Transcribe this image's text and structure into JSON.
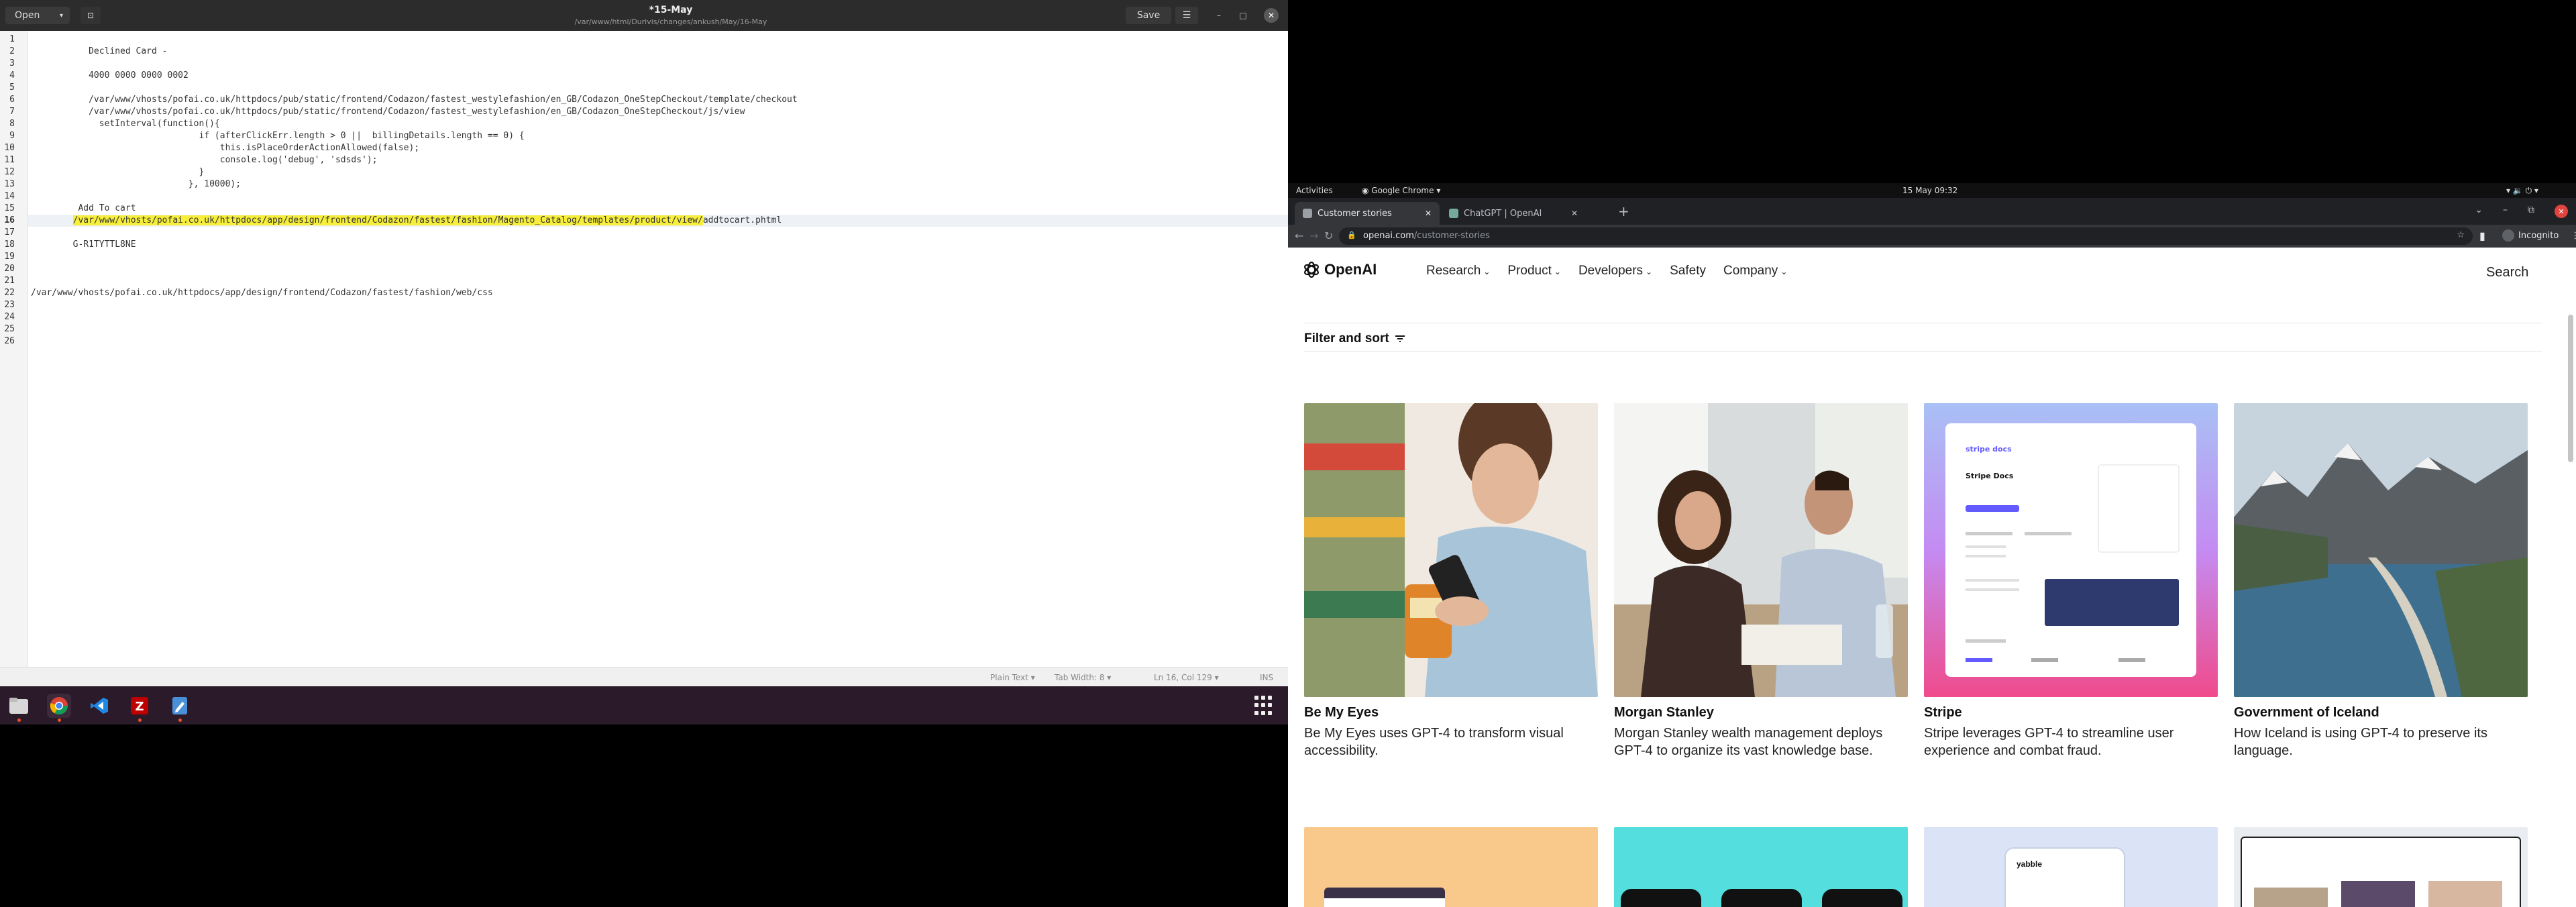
{
  "gedit": {
    "open_label": "Open",
    "title": "*15-May",
    "path": "/var/www/html/Durivis/changes/ankush/May/16-May",
    "save_label": "Save",
    "lines": [
      {
        "n": "1",
        "text": ""
      },
      {
        "n": "2",
        "text": "           Declined Card -"
      },
      {
        "n": "3",
        "text": ""
      },
      {
        "n": "4",
        "text": "           4000 0000 0000 0002"
      },
      {
        "n": "5",
        "text": ""
      },
      {
        "n": "6",
        "text": "           /var/www/vhosts/pofai.co.uk/httpdocs/pub/static/frontend/Codazon/fastest_westylefashion/en_GB/Codazon_OneStepCheckout/template/checkout"
      },
      {
        "n": "7",
        "text": "           /var/www/vhosts/pofai.co.uk/httpdocs/pub/static/frontend/Codazon/fastest_westylefashion/en_GB/Codazon_OneStepCheckout/js/view"
      },
      {
        "n": "8",
        "text": "             setInterval(function(){"
      },
      {
        "n": "9",
        "text": "                                if (afterClickErr.length > 0 ||  billingDetails.length == 0) {"
      },
      {
        "n": "10",
        "text": "                                    this.isPlaceOrderActionAllowed(false);"
      },
      {
        "n": "11",
        "text": "                                    console.log('debug', 'sdsds');"
      },
      {
        "n": "12",
        "text": "                                }"
      },
      {
        "n": "13",
        "text": "                              }, 10000);"
      },
      {
        "n": "14",
        "text": ""
      },
      {
        "n": "15",
        "text": "         Add To cart"
      },
      {
        "n": "16",
        "text": ""
      },
      {
        "n": "17",
        "text": ""
      },
      {
        "n": "18",
        "text": "        G-R1TYTTL8NE"
      },
      {
        "n": "19",
        "text": ""
      },
      {
        "n": "20",
        "text": ""
      },
      {
        "n": "21",
        "text": ""
      },
      {
        "n": "22",
        "text": "/var/www/vhosts/pofai.co.uk/httpdocs/app/design/frontend/Codazon/fastest/fashion/web/css"
      },
      {
        "n": "23",
        "text": ""
      },
      {
        "n": "24",
        "text": ""
      },
      {
        "n": "25",
        "text": ""
      },
      {
        "n": "26",
        "text": ""
      }
    ],
    "line16_prefix": "        ",
    "line16_highlight": "/var/www/vhosts/pofai.co.uk/httpdocs/app/design/frontend/Codazon/fastest/fashion/Magento_Catalog/templates/product/view/",
    "line16_rest": "addtocart.phtml",
    "status": {
      "mode": "Plain Text",
      "tab_width": "Tab Width: 8",
      "position": "Ln 16, Col 129",
      "ins": "INS"
    }
  },
  "topbar": {
    "activities": "Activities",
    "app": "Google Chrome",
    "datetime": "15 May  09:32"
  },
  "chrome": {
    "tabs": [
      {
        "label": "Customer stories",
        "active": true
      },
      {
        "label": "ChatGPT | OpenAI",
        "active": false
      }
    ],
    "url_host": "openai.com",
    "url_path": "/customer-stories",
    "incognito": "Incognito"
  },
  "page": {
    "logo": "OpenAI",
    "nav": [
      "Research",
      "Product",
      "Developers",
      "Safety",
      "Company"
    ],
    "nav_has_chevron": [
      true,
      true,
      true,
      false,
      true
    ],
    "search": "Search",
    "filter": "Filter and sort",
    "cards": [
      {
        "title": "Be My Eyes",
        "desc": "Be My Eyes uses GPT-4 to transform visual accessibility."
      },
      {
        "title": "Morgan Stanley",
        "desc": "Morgan Stanley wealth management deploys GPT-4 to organize its vast knowledge base."
      },
      {
        "title": "Stripe",
        "desc": "Stripe leverages GPT-4 to streamline user experience and combat fraud."
      },
      {
        "title": "Government of Iceland",
        "desc": "How Iceland is using GPT-4 to preserve its language."
      }
    ],
    "stripe_docs_label": "stripe docs",
    "yabble_label": "yabble"
  }
}
